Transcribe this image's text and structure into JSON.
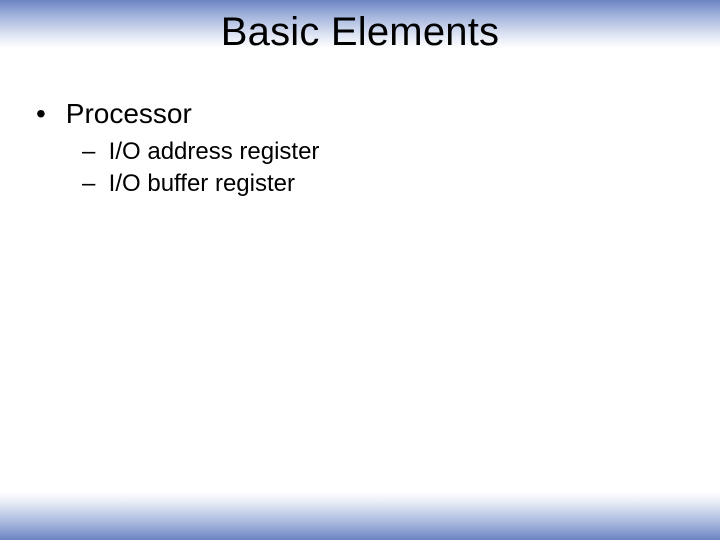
{
  "title": "Basic Elements",
  "bullets": {
    "b0": {
      "label": "Processor",
      "sub": {
        "s0": "I/O address register",
        "s1": "I/O buffer register"
      }
    }
  }
}
